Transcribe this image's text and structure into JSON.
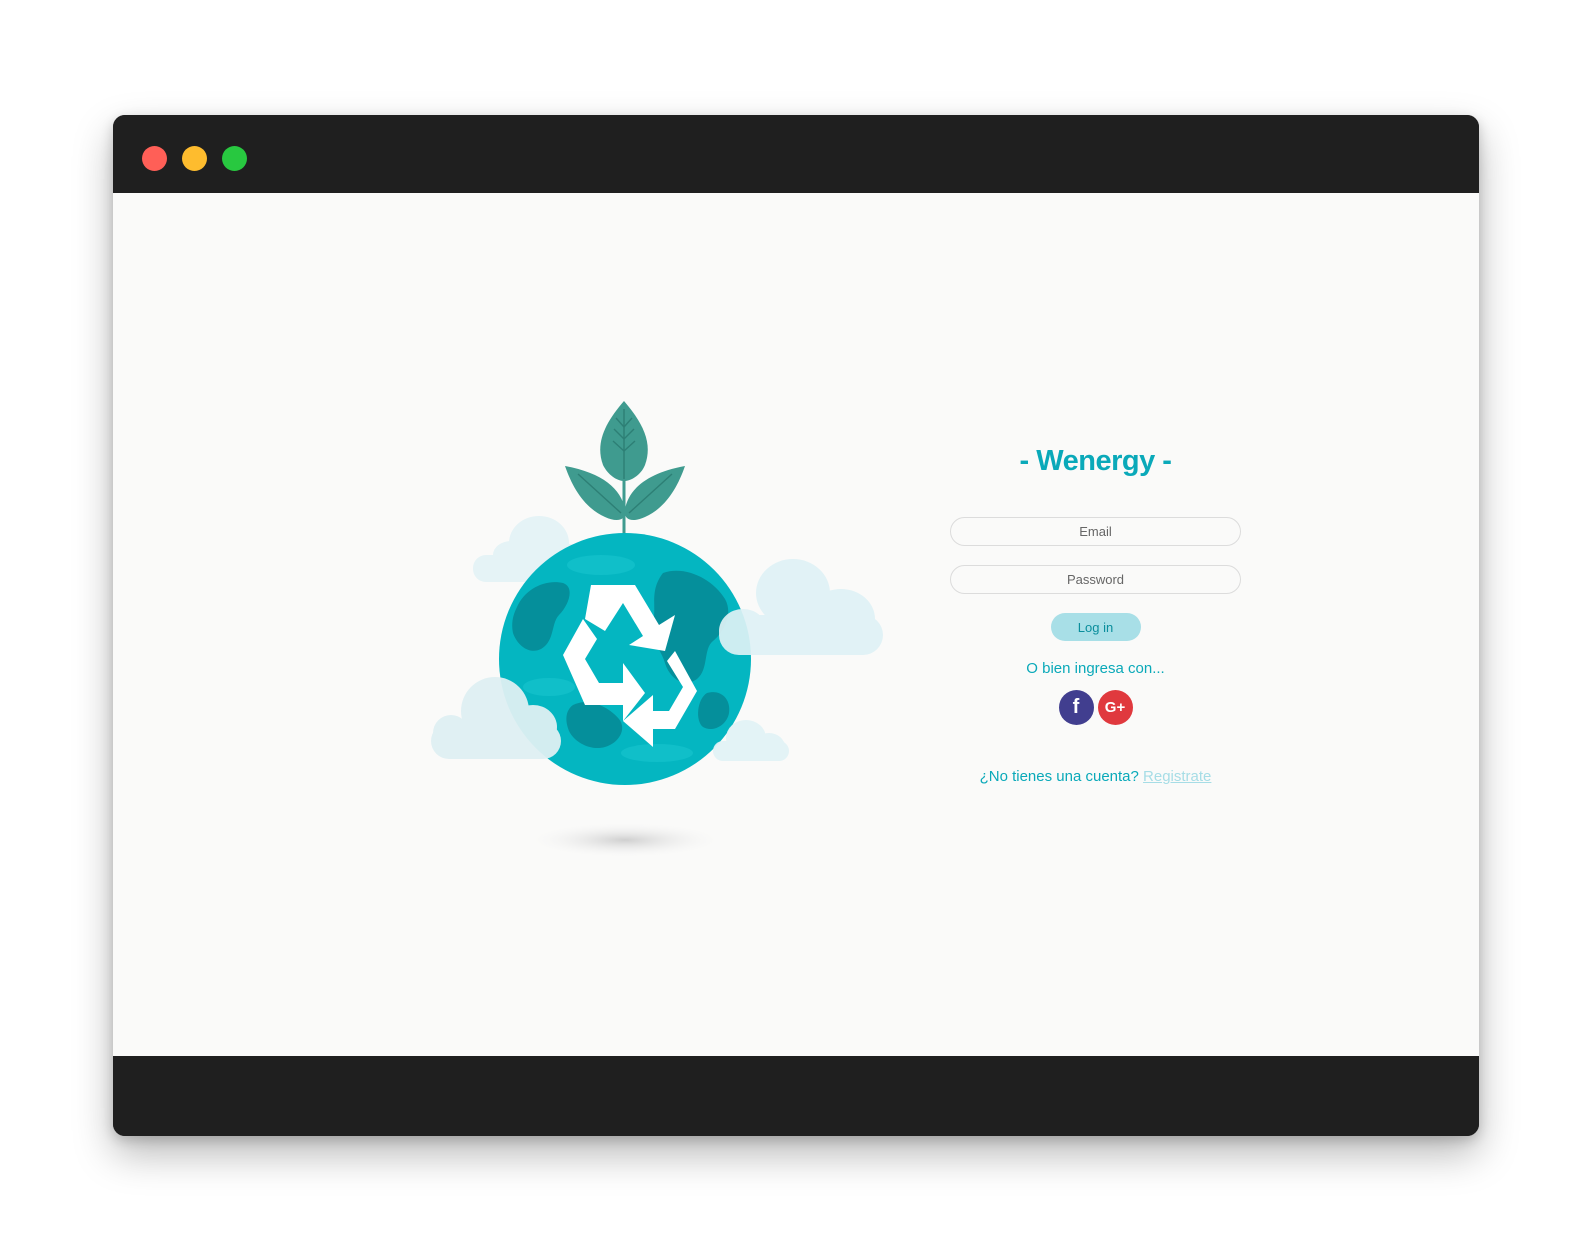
{
  "window": {
    "controls": {
      "close_color": "#ff5f57",
      "minimize_color": "#febc2e",
      "maximize_color": "#28c840"
    }
  },
  "illustration": {
    "icon": "recycle-earth-icon",
    "colors": {
      "globe": "#04b6c1",
      "land": "#058f9b",
      "leaf": "#3f9b8f",
      "cloud": "#dff2f6"
    }
  },
  "login": {
    "brand": "- Wenergy -",
    "email_placeholder": "Email",
    "password_placeholder": "Password",
    "login_label": "Log in",
    "alt_text": "O bien ingresa con...",
    "facebook_label": "f",
    "google_label": "G+",
    "no_account_text": "¿No tienes una cuenta?",
    "signup_link": "Registrate"
  },
  "colors": {
    "accent": "#0aa9b9",
    "button_bg": "#a8dfe7",
    "facebook": "#413e8f",
    "google": "#e0393e",
    "link_light": "#a6dde6"
  }
}
